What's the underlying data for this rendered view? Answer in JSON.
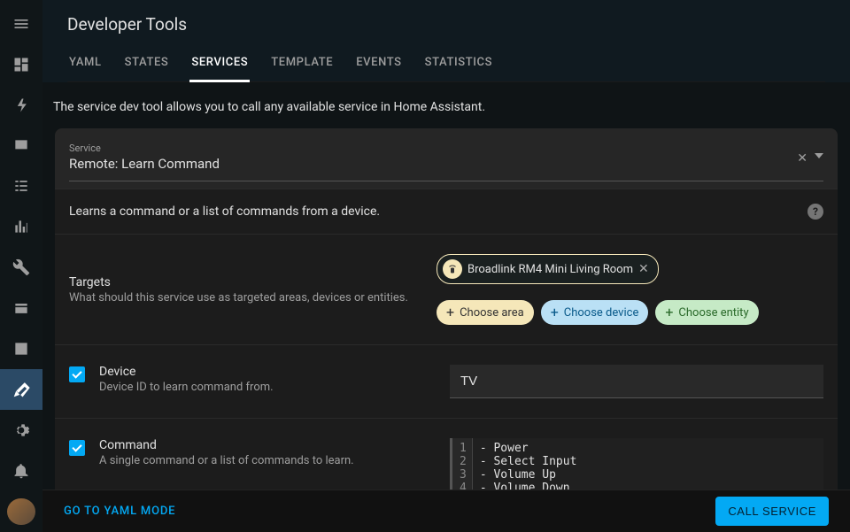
{
  "header": {
    "title": "Developer Tools",
    "tabs": [
      "YAML",
      "STATES",
      "SERVICES",
      "TEMPLATE",
      "EVENTS",
      "STATISTICS"
    ],
    "active_tab": "SERVICES"
  },
  "description": "The service dev tool allows you to call any available service in Home Assistant.",
  "service_field": {
    "label": "Service",
    "value": "Remote: Learn Command"
  },
  "service_desc": "Learns a command or a list of commands from a device.",
  "targets": {
    "label": "Targets",
    "desc": "What should this service use as targeted areas, devices or entities.",
    "selected_device": "Broadlink RM4 Mini Living Room",
    "choose_area": "Choose area",
    "choose_device": "Choose device",
    "choose_entity": "Choose entity"
  },
  "params": {
    "device": {
      "label": "Device",
      "desc": "Device ID to learn command from.",
      "value": "TV"
    },
    "command": {
      "label": "Command",
      "desc": "A single command or a list of commands to learn.",
      "lines": [
        "- Power",
        "- Select Input",
        "- Volume Up",
        "- Volume Down"
      ]
    }
  },
  "footer": {
    "yaml_mode": "GO TO YAML MODE",
    "call": "CALL SERVICE"
  }
}
